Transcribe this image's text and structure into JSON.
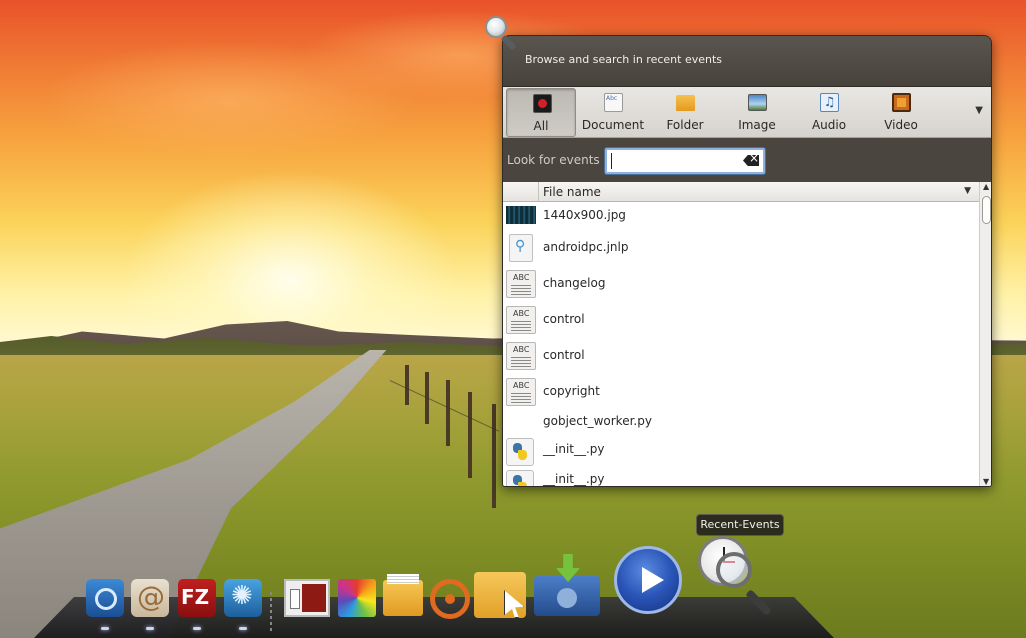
{
  "window": {
    "title": "Browse and search in recent events"
  },
  "filters": [
    {
      "label": "All",
      "icon": "all-events-icon",
      "active": true
    },
    {
      "label": "Document",
      "icon": "document-icon",
      "active": false
    },
    {
      "label": "Folder",
      "icon": "folder-icon",
      "active": false
    },
    {
      "label": "Image",
      "icon": "image-icon",
      "active": false
    },
    {
      "label": "Audio",
      "icon": "audio-icon",
      "active": false
    },
    {
      "label": "Video",
      "icon": "video-icon",
      "active": false
    }
  ],
  "search": {
    "label": "Look for events",
    "value": ""
  },
  "list": {
    "column_header": "File name",
    "rows": [
      {
        "name": "1440x900.jpg",
        "icon": "image-thumbnail-icon"
      },
      {
        "name": "androidpc.jnlp",
        "icon": "java-file-icon"
      },
      {
        "name": "changelog",
        "icon": "text-file-icon"
      },
      {
        "name": "control",
        "icon": "text-file-icon"
      },
      {
        "name": "control",
        "icon": "text-file-icon"
      },
      {
        "name": "copyright",
        "icon": "text-file-icon"
      },
      {
        "name": "gobject_worker.py",
        "icon": ""
      },
      {
        "name": "__init__.py",
        "icon": "python-file-icon"
      },
      {
        "name": "__init__.py",
        "icon": "python-file-icon"
      }
    ]
  },
  "tooltip": {
    "text": "Recent-Events"
  },
  "dock": {
    "items": [
      {
        "name": "browser-icon"
      },
      {
        "name": "shell-icon"
      },
      {
        "name": "filezilla-icon"
      },
      {
        "name": "swirl-app-icon"
      },
      {
        "name": "presentation-icon"
      },
      {
        "name": "color-palette-icon"
      },
      {
        "name": "files-icon"
      },
      {
        "name": "ubuntu-icon"
      },
      {
        "name": "folder-cursor-icon"
      },
      {
        "name": "install-icon"
      },
      {
        "name": "media-play-icon"
      },
      {
        "name": "recent-events-icon"
      }
    ]
  }
}
